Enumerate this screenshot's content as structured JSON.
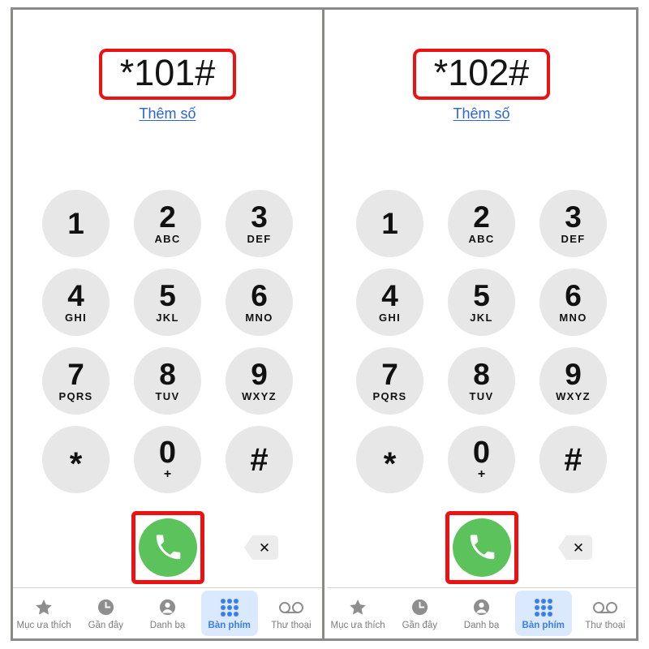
{
  "panels": [
    {
      "id": "left",
      "display": {
        "number": "*101#",
        "add_number_link": "Thêm số"
      },
      "keypad": {
        "keys": [
          {
            "digit": "1",
            "sub": ""
          },
          {
            "digit": "2",
            "sub": "ABC"
          },
          {
            "digit": "3",
            "sub": "DEF"
          },
          {
            "digit": "4",
            "sub": "GHI"
          },
          {
            "digit": "5",
            "sub": "JKL"
          },
          {
            "digit": "6",
            "sub": "MNO"
          },
          {
            "digit": "7",
            "sub": "PQRS"
          },
          {
            "digit": "8",
            "sub": "TUV"
          },
          {
            "digit": "9",
            "sub": "WXYZ"
          },
          {
            "digit": "*",
            "sub": ""
          },
          {
            "digit": "0",
            "sub": "+"
          },
          {
            "digit": "#",
            "sub": ""
          }
        ]
      },
      "actions": {
        "call_icon": "phone-handset-icon",
        "backspace_icon": "backspace-delete-icon",
        "backspace_glyph": "✕"
      },
      "tabs": [
        {
          "label": "Mục ưa thích",
          "icon": "star-icon",
          "active": false
        },
        {
          "label": "Gần đây",
          "icon": "clock-icon",
          "active": false
        },
        {
          "label": "Danh bạ",
          "icon": "person-icon",
          "active": false
        },
        {
          "label": "Bàn phím",
          "icon": "keypad-dots-icon",
          "active": true
        },
        {
          "label": "Thư thoại",
          "icon": "voicemail-icon",
          "active": false
        }
      ]
    },
    {
      "id": "right",
      "display": {
        "number": "*102#",
        "add_number_link": "Thêm số"
      },
      "keypad": {
        "keys": [
          {
            "digit": "1",
            "sub": ""
          },
          {
            "digit": "2",
            "sub": "ABC"
          },
          {
            "digit": "3",
            "sub": "DEF"
          },
          {
            "digit": "4",
            "sub": "GHI"
          },
          {
            "digit": "5",
            "sub": "JKL"
          },
          {
            "digit": "6",
            "sub": "MNO"
          },
          {
            "digit": "7",
            "sub": "PQRS"
          },
          {
            "digit": "8",
            "sub": "TUV"
          },
          {
            "digit": "9",
            "sub": "WXYZ"
          },
          {
            "digit": "*",
            "sub": ""
          },
          {
            "digit": "0",
            "sub": "+"
          },
          {
            "digit": "#",
            "sub": ""
          }
        ]
      },
      "actions": {
        "call_icon": "phone-handset-icon",
        "backspace_icon": "backspace-delete-icon",
        "backspace_glyph": "✕"
      },
      "tabs": [
        {
          "label": "Mục ưa thích",
          "icon": "star-icon",
          "active": false
        },
        {
          "label": "Gần đây",
          "icon": "clock-icon",
          "active": false
        },
        {
          "label": "Danh bạ",
          "icon": "person-icon",
          "active": false
        },
        {
          "label": "Bàn phím",
          "icon": "keypad-dots-icon",
          "active": true
        },
        {
          "label": "Thư thoại",
          "icon": "voicemail-icon",
          "active": false
        }
      ]
    }
  ],
  "colors": {
    "highlight_red": "#ee1111",
    "call_green": "#5cc35c",
    "link_blue": "#2c64d4",
    "tab_active_blue": "#3b7ef0",
    "tab_active_pill": "#dbe9fe",
    "key_gray": "#e7e7e7",
    "frame_gray": "#8a8a88"
  }
}
